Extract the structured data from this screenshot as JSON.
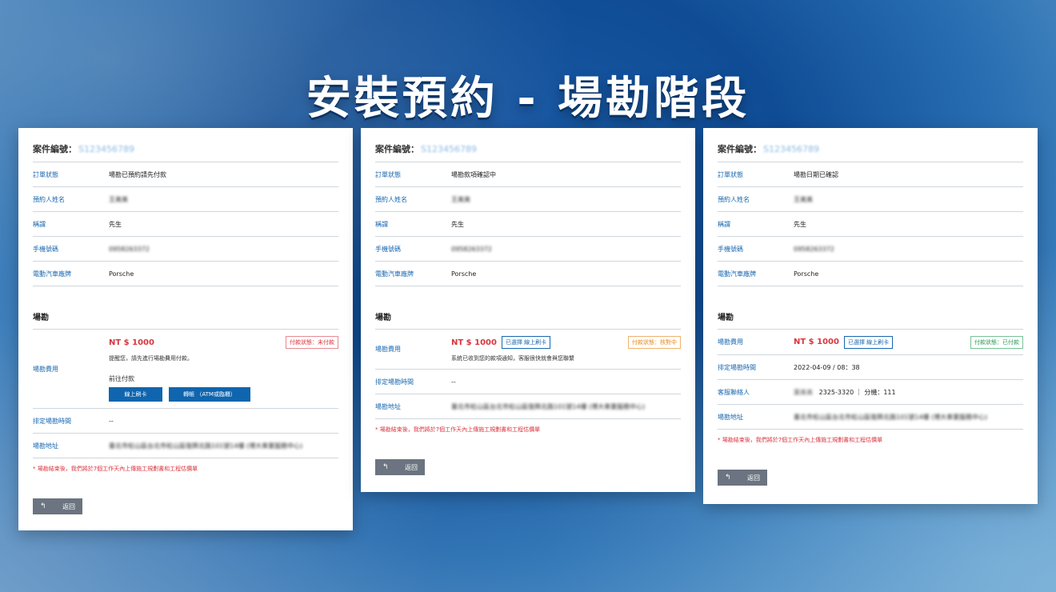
{
  "headline": "安裝預約 - 場勘階段",
  "labels": {
    "case_no": "案件編號：",
    "order_status": "訂單狀態",
    "name": "預約人姓名",
    "title": "稱謂",
    "phone": "手機號碼",
    "brand": "電動汽車廠牌",
    "section": "場勘",
    "fee": "場勘費用",
    "time": "排定場勘時間",
    "contact": "客服聯絡人",
    "address": "場勘地址",
    "back": "返回",
    "back_icon": "↰"
  },
  "cards": [
    {
      "case_no": "S123456789",
      "order_status": "場勘已預約請先付款",
      "name": "王美美",
      "title": "先生",
      "phone": "0958263372",
      "brand": "Porsche",
      "price": "NT $ 1000",
      "pay_status": "付款狀態：未付款",
      "fee_note": "提醒您，請先進行場勘費用付款。",
      "go_pay": "前往付款",
      "btn_card": "線上刷卡",
      "btn_transfer": "轉帳 （ATM或臨櫃）",
      "time": "--",
      "address": "臺北市松山區台北市松山區復興北路101號14樓 (博大車業服務中心)",
      "remark": "* 場勘結束後，我們將於7個工作天內上傳施工規劃書和工程估價單"
    },
    {
      "case_no": "S123456789",
      "order_status": "場勘款項確認中",
      "name": "王美美",
      "title": "先生",
      "phone": "0958263372",
      "brand": "Porsche",
      "price": "NT $ 1000",
      "method": "已選擇 線上刷卡",
      "pay_status": "付款狀態：核對中",
      "fee_note": "系統已收到您的款項通知，客服很快就會與您聯繫",
      "time": "--",
      "address": "臺北市松山區台北市松山區復興北路101號14樓 (博大車業服務中心)",
      "remark": "* 場勘結束後，我們將於7個工作天內上傳施工規劃書和工程估價單"
    },
    {
      "case_no": "S123456789",
      "order_status": "場勘日期已確認",
      "name": "王美美",
      "title": "先生",
      "phone": "0958263372",
      "brand": "Porsche",
      "price": "NT $ 1000",
      "method": "已選擇 線上刷卡",
      "pay_status": "付款狀態：已付款",
      "time": "2022-04-09 / 08：38",
      "contact_name": "葉美美",
      "contact_phone": "2325-3320 ｜ 分機：111",
      "address": "臺北市松山區台北市松山區復興北路101號14樓 (博大車業服務中心)",
      "remark": "* 場勘結束後，我們將於7個工作天內上傳施工規劃書和工程估價單"
    }
  ],
  "colors": {
    "accent_blue": "#0f65ae",
    "label_blue": "#1867b0",
    "price_red": "#d9363e",
    "status_orange": "#e88a1e",
    "status_green": "#2c9b5a",
    "back_gray": "#6b7480"
  }
}
